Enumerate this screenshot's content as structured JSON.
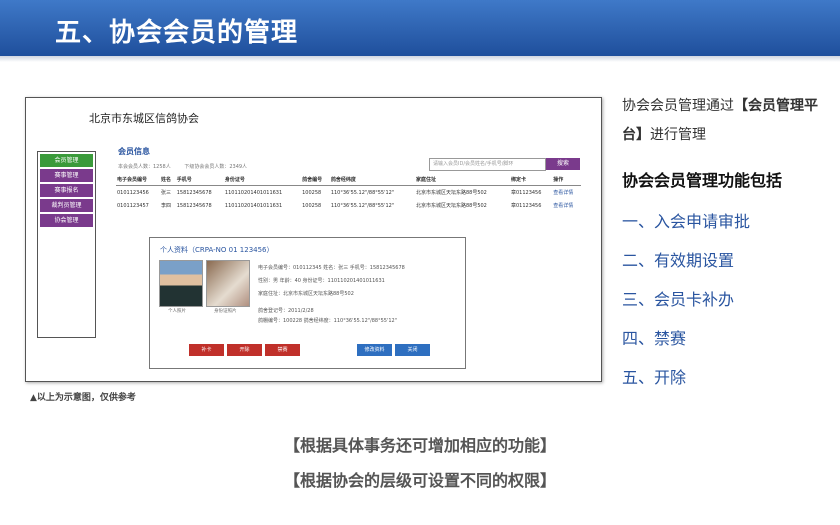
{
  "slide": {
    "title": "五、协会会员的管理",
    "note": "▲以上为示意图，仅供参考",
    "intro_prefix": "协会会员管理通过",
    "intro_highlight": "【会员管理平台】",
    "intro_suffix": "进行管理",
    "features_heading": "协会会员管理功能包括",
    "features": [
      "一、入会申请审批",
      "二、有效期设置",
      "三、会员卡补办",
      "四、禁赛",
      "五、开除"
    ],
    "footer": [
      "【根据具体事务还可增加相应的功能】",
      "【根据协会的层级可设置不同的权限】"
    ]
  },
  "mockup": {
    "org_name": "北京市东城区信鸽协会",
    "sidebar": [
      "会员管理",
      "赛事管理",
      "赛事报名",
      "裁判员管理",
      "协会管理"
    ],
    "section_title": "会员信息",
    "counts": [
      "本会会员人数：1258人",
      "下级协会会员人数：2349人"
    ],
    "search_placeholder": "请输入会员ID/会员姓名/手机号/脚环",
    "search_button": "搜索",
    "columns": [
      "电子会员编号",
      "姓名",
      "手机号",
      "身份证号",
      "鸽舍编号",
      "鸽舍经纬度",
      "家庭住址",
      "绑定卡",
      "操作"
    ],
    "rows": [
      [
        "0101123456",
        "张三",
        "15812345678",
        "110110201401011631",
        "100258",
        "110°36'55.12\"/88°55'12\"",
        "北京市东城区天坛东路88号502",
        "章01123456",
        "查看详情"
      ],
      [
        "0101123457",
        "李四",
        "15812345678",
        "110110201401011631",
        "100258",
        "110°36'55.12\"/88°55'12\"",
        "北京市东城区天坛东路88号502",
        "章01123456",
        "查看详情"
      ]
    ],
    "popup": {
      "title": "个人资料（CRPA-NO 01 123456）",
      "photo_caption": "个人照片",
      "cert_caption": "身份证照片",
      "lines": [
        "电子会员编号：010112345  姓名：张三  手机号：15812345678",
        "性别：男          年龄：40      身份证号：110110201401011631",
        "家庭住址：北京市东城区天坛东路88号502",
        "鸽舍登记号：2011/2/28",
        "鸽棚编号：100228        鸽舍经纬度：110°36'55.12\"/88°55'12\""
      ],
      "buttons_red": [
        "补卡",
        "开除",
        "禁赛"
      ],
      "buttons_blue": [
        "修改资料",
        "关闭"
      ]
    }
  }
}
